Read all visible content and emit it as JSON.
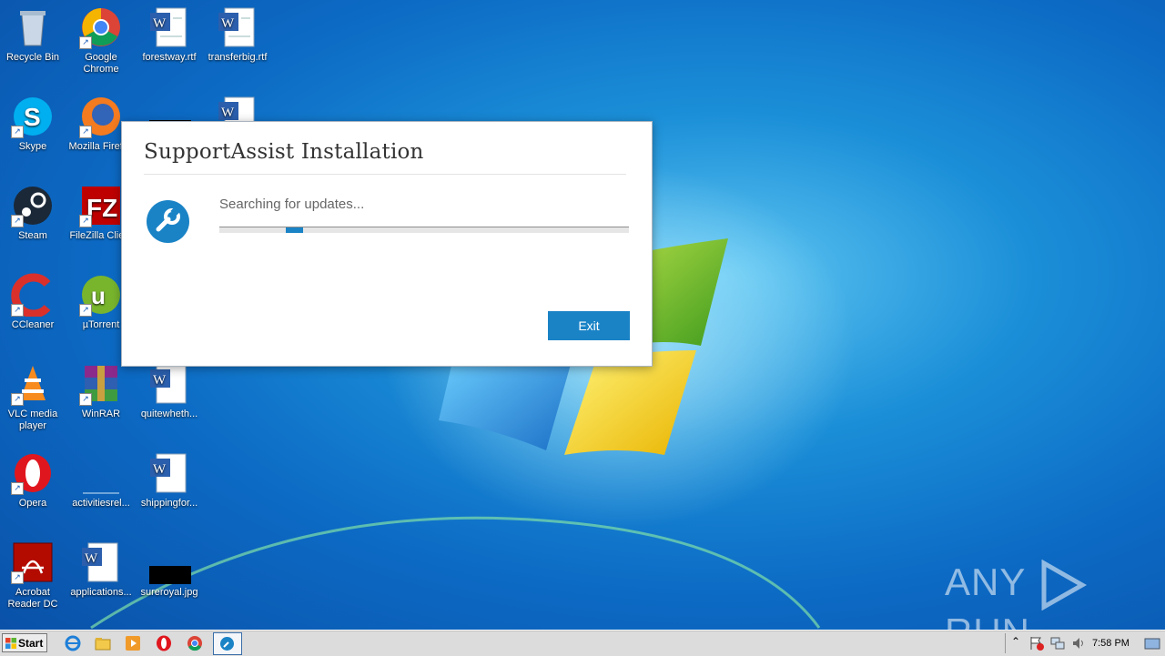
{
  "desktop": {
    "icons": [
      {
        "label": "Recycle Bin"
      },
      {
        "label": "Google Chrome"
      },
      {
        "label": "forestway.rtf"
      },
      {
        "label": "transferbig.rtf"
      },
      {
        "label": "Skype"
      },
      {
        "label": "Mozilla Firefox"
      },
      {
        "label": "Steam"
      },
      {
        "label": "FileZilla Client"
      },
      {
        "label": "CCleaner"
      },
      {
        "label": "µTorrent"
      },
      {
        "label": "VLC media player"
      },
      {
        "label": "WinRAR"
      },
      {
        "label": "quitewheth..."
      },
      {
        "label": "Opera"
      },
      {
        "label": "activitiesrel..."
      },
      {
        "label": "shippingfor..."
      },
      {
        "label": "Acrobat Reader DC"
      },
      {
        "label": "applications..."
      },
      {
        "label": "sureroyal.jpg"
      }
    ]
  },
  "dialog": {
    "title": "SupportAssist Installation",
    "status": "Searching for updates...",
    "exit_label": "Exit",
    "accent": "#1a83c6",
    "progress_icon": "wrench-icon"
  },
  "taskbar": {
    "start_label": "Start",
    "clock": "7:58 PM"
  },
  "watermark": {
    "text_left": "ANY",
    "text_right": "RUN"
  }
}
